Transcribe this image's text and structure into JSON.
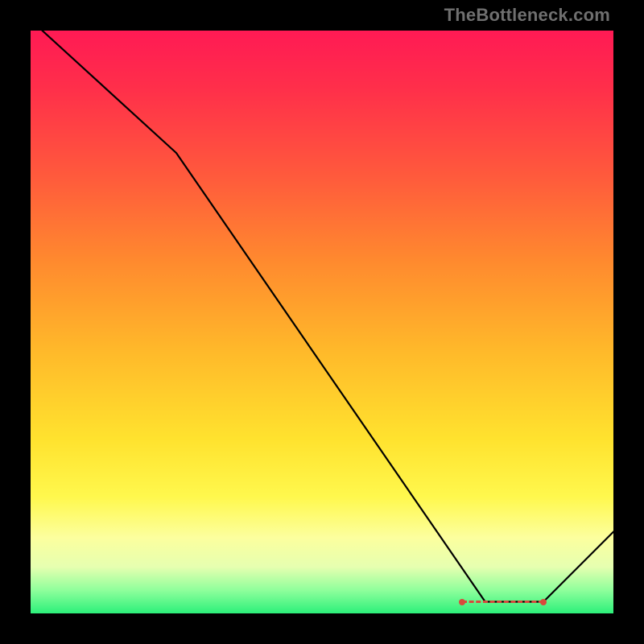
{
  "watermark": "TheBottleneck.com",
  "chart_data": {
    "type": "line",
    "title": "",
    "xlabel": "",
    "ylabel": "",
    "xlim": [
      0,
      100
    ],
    "ylim": [
      0,
      100
    ],
    "series": [
      {
        "name": "curve",
        "x": [
          2,
          25,
          78,
          88,
          100
        ],
        "values": [
          100,
          79,
          2,
          2,
          14
        ]
      }
    ],
    "valley_marker": {
      "x_start": 74,
      "x_end": 88,
      "y": 2
    },
    "background_gradient": {
      "top": "#ff1a54",
      "bottom": "#2cf07a"
    }
  }
}
